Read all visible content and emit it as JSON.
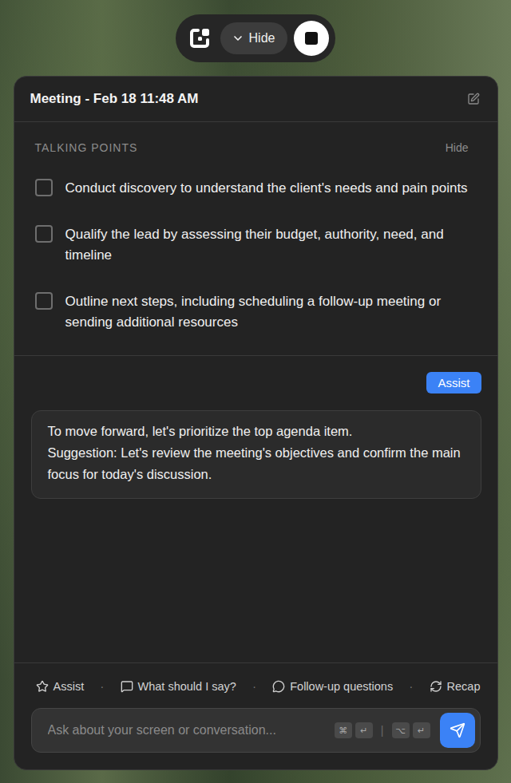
{
  "toolbar": {
    "hide_label": "Hide"
  },
  "meeting": {
    "title": "Meeting - Feb 18 11:48 AM"
  },
  "talking_points": {
    "heading": "TALKING POINTS",
    "toggle": "Hide",
    "items": [
      {
        "text": "Conduct discovery to understand the client's needs and pain points",
        "checked": false
      },
      {
        "text": "Qualify the lead by assessing their budget, authority, need, and timeline",
        "checked": false
      },
      {
        "text": "Outline next steps, including scheduling a follow-up meeting or sending additional resources",
        "checked": false
      }
    ]
  },
  "chat": {
    "messages": [
      {
        "role": "user",
        "lines": [
          "Assist"
        ]
      },
      {
        "role": "assistant",
        "lines": [
          "To move forward, let's prioritize the top agenda item.",
          "Suggestion: Let's review the meeting's objectives and confirm the main focus for today's discussion."
        ]
      }
    ]
  },
  "quick_actions": [
    {
      "label": "Assist"
    },
    {
      "label": "What should I say?"
    },
    {
      "label": "Follow-up questions"
    },
    {
      "label": "Recap"
    }
  ],
  "separator": "·",
  "input": {
    "placeholder": "Ask about your screen or conversation...",
    "shortcuts": [
      [
        "⌘",
        "↵"
      ],
      [
        "⌥",
        "↵"
      ]
    ],
    "divider": "|"
  }
}
